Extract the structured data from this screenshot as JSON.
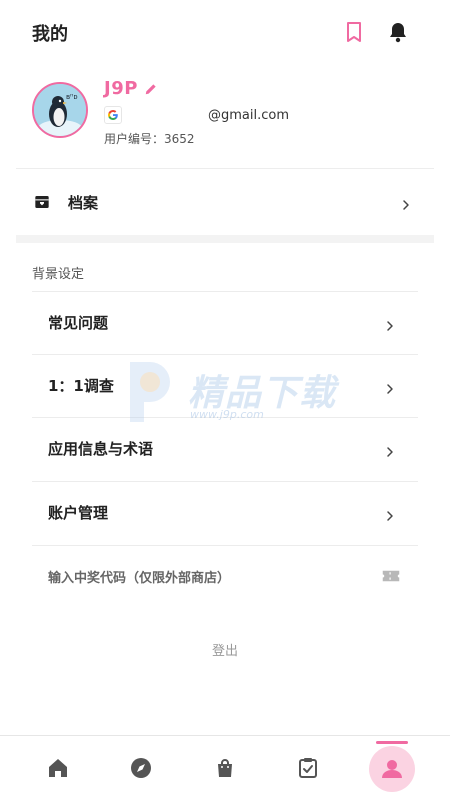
{
  "header": {
    "title": "我的",
    "bookmark_icon": "bookmark-icon",
    "bell_icon": "bell-icon"
  },
  "profile": {
    "username": "J9P",
    "email": "@gmail.com",
    "user_id": "用户编号：3652",
    "avatar_icon": "penguin-avatar"
  },
  "archive": {
    "label": "档案"
  },
  "settings": {
    "section_title": "背景设定",
    "items": [
      {
        "label": "常见问题"
      },
      {
        "label": "1：1调查"
      },
      {
        "label": "应用信息与术语"
      },
      {
        "label": "账户管理"
      }
    ],
    "coupon_label": "输入中奖代码（仅限外部商店）"
  },
  "logout_label": "登出",
  "watermark": {
    "text": "精品下载",
    "url": "www.j9p.com"
  },
  "bottom_nav": [
    "home-icon",
    "compass-icon",
    "shopping-bag-icon",
    "clipboard-check-icon",
    "profile-icon"
  ],
  "colors": {
    "accent": "#f06aa1",
    "accent_light": "#fbd3e2"
  }
}
